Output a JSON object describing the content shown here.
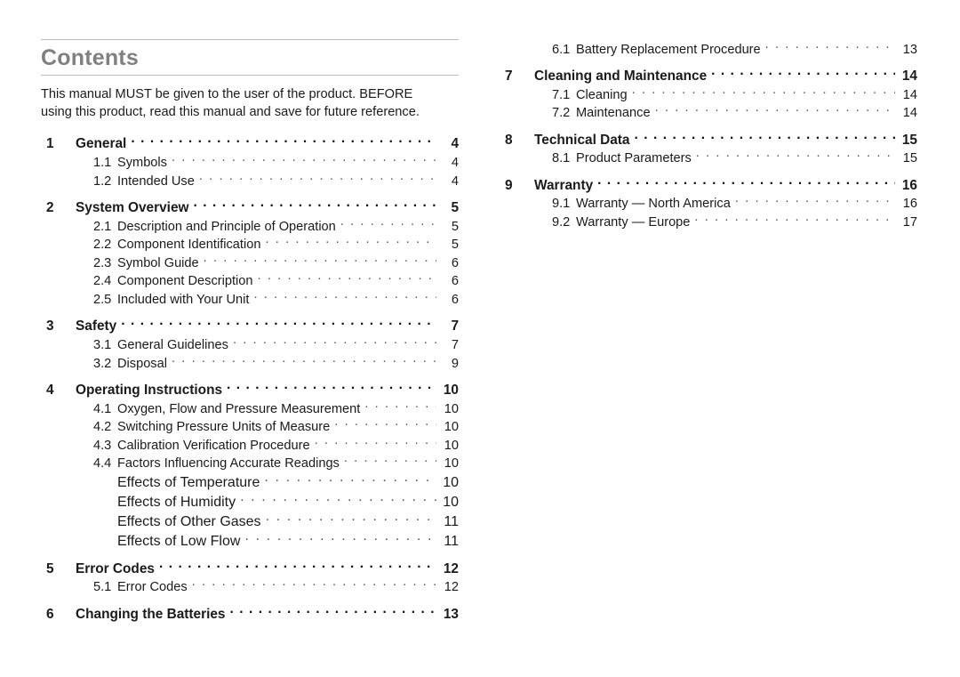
{
  "document": {
    "heading": "Contents",
    "intro": "This manual MUST be given to the user of the product. BEFORE using this product, read this manual and save for future reference.",
    "heading_color": "#808080",
    "rule_color": "#bfbfbf",
    "text_color": "#1a1a1a"
  },
  "toc": {
    "left_column": [
      {
        "level": 1,
        "number": "1",
        "title": "General",
        "page": "4"
      },
      {
        "level": 2,
        "number": "1.1",
        "title": "Symbols",
        "page": "4"
      },
      {
        "level": 2,
        "number": "1.2",
        "title": "Intended Use",
        "page": "4"
      },
      {
        "level": 1,
        "number": "2",
        "title": "System Overview",
        "page": "5"
      },
      {
        "level": 2,
        "number": "2.1",
        "title": "Description and Principle of Operation",
        "page": "5"
      },
      {
        "level": 2,
        "number": "2.2",
        "title": "Component Identification",
        "page": "5"
      },
      {
        "level": 2,
        "number": "2.3",
        "title": "Symbol Guide",
        "page": "6"
      },
      {
        "level": 2,
        "number": "2.4",
        "title": "Component Description",
        "page": "6"
      },
      {
        "level": 2,
        "number": "2.5",
        "title": "Included with Your Unit",
        "page": "6"
      },
      {
        "level": 1,
        "number": "3",
        "title": "Safety",
        "page": "7"
      },
      {
        "level": 2,
        "number": "3.1",
        "title": "General Guidelines",
        "page": "7"
      },
      {
        "level": 2,
        "number": "3.2",
        "title": "Disposal",
        "page": "9"
      },
      {
        "level": 1,
        "number": "4",
        "title": "Operating Instructions",
        "page": "10"
      },
      {
        "level": 2,
        "number": "4.1",
        "title": "Oxygen, Flow and Pressure Measurement",
        "page": "10"
      },
      {
        "level": 2,
        "number": "4.2",
        "title": "Switching Pressure Units of Measure",
        "page": "10"
      },
      {
        "level": 2,
        "number": "4.3",
        "title": "Calibration Verification Procedure",
        "page": "10"
      },
      {
        "level": 2,
        "number": "4.4",
        "title": "Factors Influencing Accurate Readings",
        "page": "10"
      },
      {
        "level": 3,
        "number": "",
        "title": "Effects of Temperature",
        "page": "10"
      },
      {
        "level": 3,
        "number": "",
        "title": "Effects of Humidity",
        "page": "10"
      },
      {
        "level": 3,
        "number": "",
        "title": "Effects of Other Gases",
        "page": "11"
      },
      {
        "level": 3,
        "number": "",
        "title": "Effects of Low Flow",
        "page": "11"
      },
      {
        "level": 1,
        "number": "5",
        "title": "Error Codes",
        "page": "12"
      },
      {
        "level": 2,
        "number": "5.1",
        "title": "Error Codes",
        "page": "12"
      },
      {
        "level": 1,
        "number": "6",
        "title": "Changing the Batteries",
        "page": "13"
      }
    ],
    "right_column": [
      {
        "level": 2,
        "number": "6.1",
        "title": "Battery Replacement Procedure",
        "page": "13"
      },
      {
        "level": 1,
        "number": "7",
        "title": "Cleaning and Maintenance",
        "page": "14"
      },
      {
        "level": 2,
        "number": "7.1",
        "title": "Cleaning",
        "page": "14"
      },
      {
        "level": 2,
        "number": "7.2",
        "title": "Maintenance",
        "page": "14"
      },
      {
        "level": 1,
        "number": "8",
        "title": "Technical Data",
        "page": "15"
      },
      {
        "level": 2,
        "number": "8.1",
        "title": "Product Parameters",
        "page": "15"
      },
      {
        "level": 1,
        "number": "9",
        "title": "Warranty",
        "page": "16"
      },
      {
        "level": 2,
        "number": "9.1",
        "title": "Warranty — North America",
        "page": "16"
      },
      {
        "level": 2,
        "number": "9.2",
        "title": "Warranty — Europe",
        "page": "17"
      }
    ]
  }
}
